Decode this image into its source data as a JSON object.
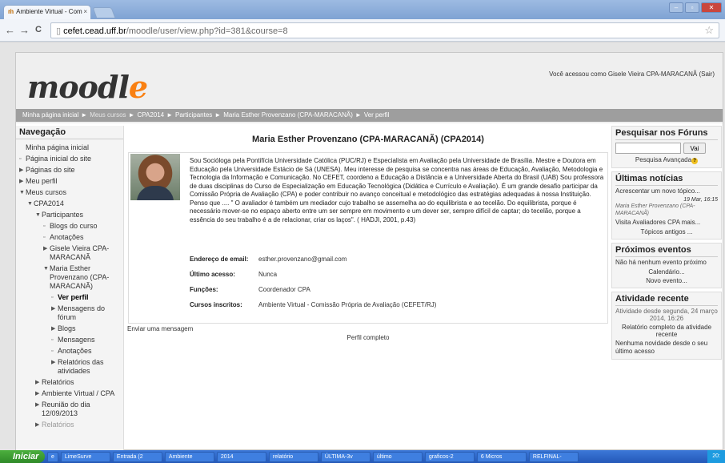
{
  "browser": {
    "tab_title": "Ambiente Virtual - Com",
    "tab_close": "×",
    "url_host": "cefet.cead.uff.br",
    "url_path": "/moodle/user/view.php?id=381&course=8",
    "star": "☆",
    "back": "←",
    "forward": "→",
    "reload": "C"
  },
  "header": {
    "logo_main": "moodl",
    "logo_end": "e",
    "login_info": "Você acessou como Gisele Vieira CPA-MARACANÃ (Sair)"
  },
  "breadcrumb": [
    {
      "label": "Minha página inicial",
      "muted": false
    },
    {
      "label": "Meus cursos",
      "muted": true
    },
    {
      "label": "CPA2014",
      "muted": false
    },
    {
      "label": "Participantes",
      "muted": false
    },
    {
      "label": "Maria Esther Provenzano (CPA-MARACANÃ)",
      "muted": false
    },
    {
      "label": "Ver perfil",
      "muted": false
    }
  ],
  "breadcrumb_sep": "►",
  "navigation": {
    "title": "Navegação",
    "items": [
      {
        "label": "Minha página inicial",
        "bullet": "",
        "indent": 0,
        "style": ""
      },
      {
        "label": "Página inicial do site",
        "bullet": "▫",
        "indent": 0,
        "style": ""
      },
      {
        "label": "Páginas do site",
        "bullet": "▶",
        "indent": 0,
        "style": ""
      },
      {
        "label": "Meu perfil",
        "bullet": "▶",
        "indent": 0,
        "style": ""
      },
      {
        "label": "Meus cursos",
        "bullet": "▼",
        "indent": 0,
        "style": ""
      },
      {
        "label": "CPA2014",
        "bullet": "▼",
        "indent": 1,
        "style": ""
      },
      {
        "label": "Participantes",
        "bullet": "▼",
        "indent": 2,
        "style": ""
      },
      {
        "label": "Blogs do curso",
        "bullet": "▫",
        "indent": 3,
        "style": ""
      },
      {
        "label": "Anotações",
        "bullet": "▫",
        "indent": 3,
        "style": ""
      },
      {
        "label": "Gisele Vieira CPA-MARACANÃ",
        "bullet": "▶",
        "indent": 3,
        "style": ""
      },
      {
        "label": "Maria Esther Provenzano (CPA-MARACANÃ)",
        "bullet": "▼",
        "indent": 3,
        "style": ""
      },
      {
        "label": "Ver perfil",
        "bullet": "▫",
        "indent": 4,
        "style": "strong"
      },
      {
        "label": "Mensagens do fórum",
        "bullet": "▶",
        "indent": 4,
        "style": ""
      },
      {
        "label": "Blogs",
        "bullet": "▶",
        "indent": 4,
        "style": ""
      },
      {
        "label": "Mensagens",
        "bullet": "▫",
        "indent": 4,
        "style": ""
      },
      {
        "label": "Anotações",
        "bullet": "▫",
        "indent": 4,
        "style": ""
      },
      {
        "label": "Relatórios das atividades",
        "bullet": "▶",
        "indent": 4,
        "style": ""
      },
      {
        "label": "Relatórios",
        "bullet": "▶",
        "indent": 2,
        "style": ""
      },
      {
        "label": "Ambiente Virtual / CPA",
        "bullet": "▶",
        "indent": 2,
        "style": ""
      },
      {
        "label": "Reunião do dia 12/09/2013",
        "bullet": "▶",
        "indent": 2,
        "style": ""
      },
      {
        "label": "Relatórios",
        "bullet": "▶",
        "indent": 2,
        "style": "muted"
      }
    ]
  },
  "profile": {
    "heading": "Maria Esther Provenzano (CPA-MARACANÃ) (CPA2014)",
    "description": "Sou Socióloga pela Pontifícia Universidade Católica (PUC/RJ) e Especialista em Avaliação pela Universidade de Brasília. Mestre e Doutora em Educação pela Universidade Estácio de Sá (UNESA). Meu interesse de pesquisa se concentra nas áreas de Educação, Avaliação, Metodologia e Tecnologia da Informação e Comunicação. No CEFET, coordeno a Educação a Distância e a Universidade Aberta do Brasil (UAB) Sou professora de duas disciplinas do Curso de Especialização em Educação Tecnológica (Didática e Currículo e Avaliação). É um grande desafio participar da Comissão Própria de Avaliação (CPA) e poder contribuir no avanço conceitual e metodológico das estratégias adequadas à nossa Instituição. Penso que .... \" O avaliador é também um mediador cujo trabalho se assemelha ao do equilibrista e ao tecelão. Do equilibrista, porque é necessário mover-se no espaço aberto entre um ser sempre em movimento e um dever ser, sempre difícil de captar; do tecelão, porque a essência do seu trabalho é a de relacionar, criar os laços\". ( HADJI, 2001, p.43)",
    "fields": [
      {
        "label": "Endereço de email:",
        "value": "esther.provenzano@gmail.com"
      },
      {
        "label": "Último acesso:",
        "value": "Nunca"
      },
      {
        "label": "Funções:",
        "value": "Coordenador CPA"
      },
      {
        "label": "Cursos inscritos:",
        "value": "Ambiente Virtual - Comissão Própria de Avaliação (CEFET/RJ)"
      }
    ],
    "send_message": "Enviar uma mensagem",
    "full_profile": "Perfil completo"
  },
  "right": {
    "search": {
      "title": "Pesquisar nos Fóruns",
      "button": "Vai",
      "advanced": "Pesquisa Avançada",
      "help": "?"
    },
    "news": {
      "title": "Últimas notícias",
      "add_topic": "Acrescentar um novo tópico...",
      "date": "19 Mar, 16:15",
      "author": "Maria Esther Provenzano (CPA-MARACANÃ)",
      "post": "Visita Avaliadores CPA mais...",
      "older": "Tópicos antigos ..."
    },
    "events": {
      "title": "Próximos eventos",
      "none": "Não há nenhum evento próximo",
      "calendar": "Calendário...",
      "new_event": "Novo evento..."
    },
    "activity": {
      "title": "Atividade recente",
      "since": "Atividade desde segunda, 24 março 2014, 16:26",
      "full_report": "Relatório completo da atividade recente",
      "no_news": "Nenhuma novidade desde o seu último acesso"
    }
  },
  "taskbar": {
    "start": "Iniciar",
    "items": [
      "LimeSurve",
      "Entrada (2",
      "Ambiente",
      "2014",
      "relatório",
      "ÚLTIMA-3v",
      "último",
      "graficos-2",
      "6 Micros",
      "RELFINAL-"
    ],
    "clock": "20:"
  }
}
